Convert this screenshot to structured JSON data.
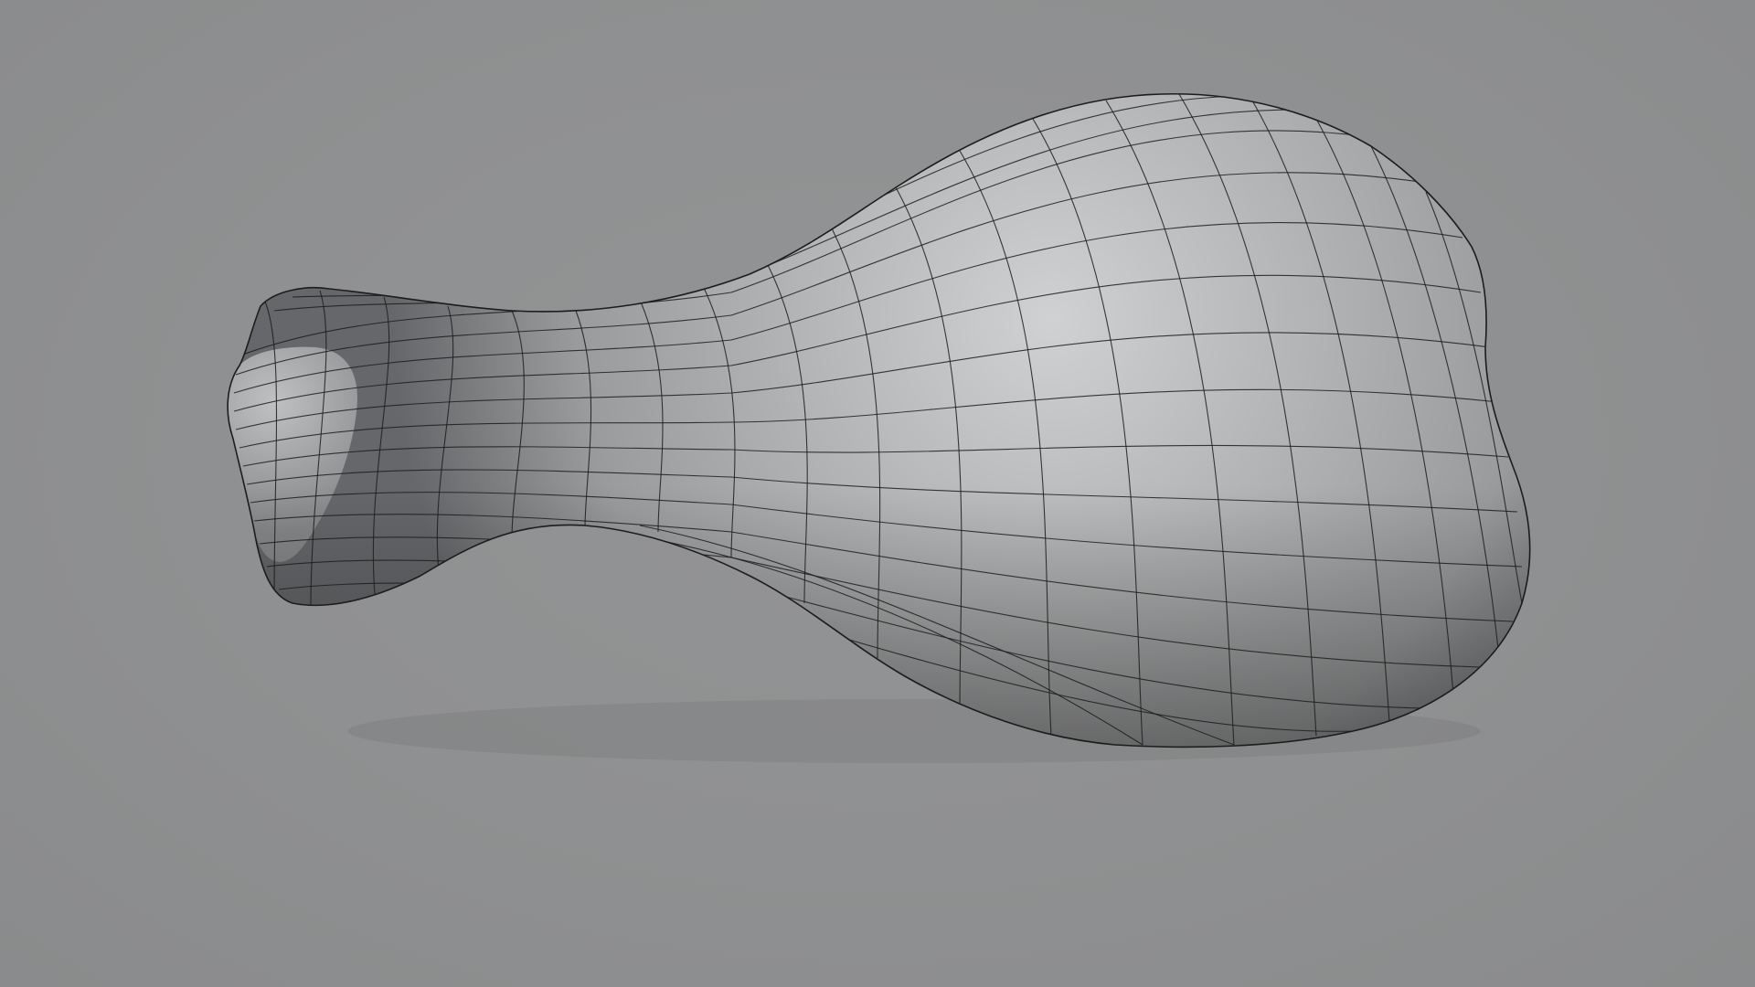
{
  "viewport": {
    "background_color": "#8e8f90",
    "object": {
      "name": "drumstick-mesh",
      "shading": "solid-gray-with-wireframe",
      "surface_color": "#a9aaab",
      "highlight_color": "#d0d1d2",
      "shadow_color": "#5e5f60",
      "wire_color": "#1c1c1c"
    }
  }
}
